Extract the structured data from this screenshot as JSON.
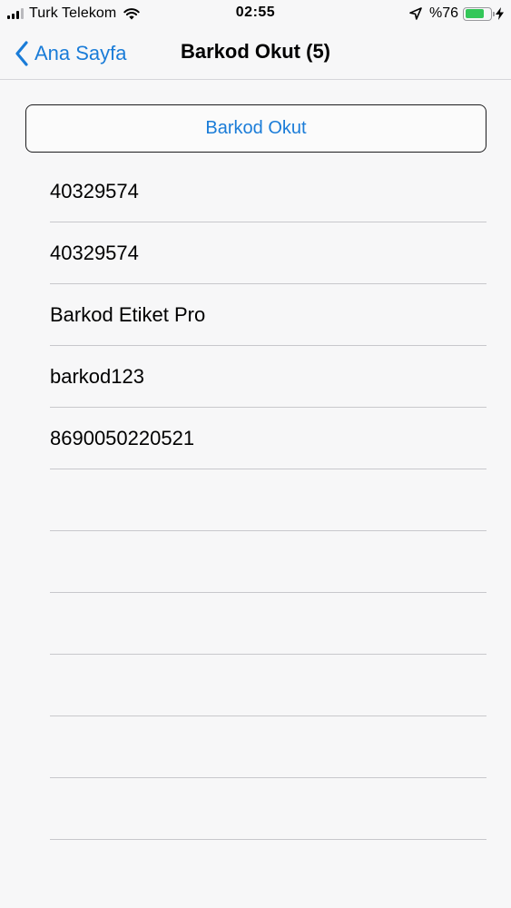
{
  "status_bar": {
    "carrier": "Turk Telekom",
    "time": "02:55",
    "battery_percent": "%76",
    "battery_level": 0.76,
    "icons": [
      "signal-icon",
      "wifi-icon",
      "location-icon",
      "battery-icon",
      "charging-bolt-icon"
    ]
  },
  "nav": {
    "back_label": "Ana Sayfa",
    "title": "Barkod Okut (5)"
  },
  "main": {
    "scan_button_label": "Barkod Okut",
    "items": [
      "40329574",
      "40329574",
      "Barkod Etiket Pro",
      "barkod123",
      "8690050220521",
      "",
      "",
      "",
      "",
      "",
      "",
      ""
    ]
  },
  "colors": {
    "accent": "#1a7cd8",
    "background": "#f7f7f8",
    "separator": "#c8c8cc",
    "battery": "#34c759"
  }
}
